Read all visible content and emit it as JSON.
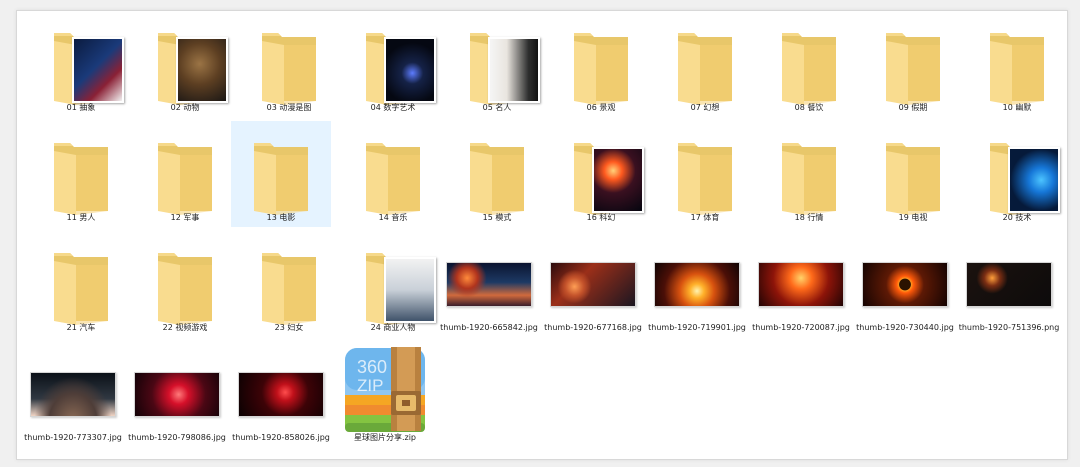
{
  "folders": [
    {
      "name": "01 抽象",
      "thumb": "abstract"
    },
    {
      "name": "02 动物",
      "thumb": "animal"
    },
    {
      "name": "03 动漫是图",
      "thumb": ""
    },
    {
      "name": "04 数字艺术",
      "thumb": "space"
    },
    {
      "name": "05 名人",
      "thumb": "person"
    },
    {
      "name": "06 景观",
      "thumb": ""
    },
    {
      "name": "07 幻想",
      "thumb": ""
    },
    {
      "name": "08 餐饮",
      "thumb": ""
    },
    {
      "name": "09 假期",
      "thumb": ""
    },
    {
      "name": "10 幽默",
      "thumb": ""
    },
    {
      "name": "11 男人",
      "thumb": ""
    },
    {
      "name": "12 军事",
      "thumb": ""
    },
    {
      "name": "13 电影",
      "thumb": "",
      "selected": true
    },
    {
      "name": "14 音乐",
      "thumb": ""
    },
    {
      "name": "15 模式",
      "thumb": ""
    },
    {
      "name": "16 科幻",
      "thumb": "scifi"
    },
    {
      "name": "17 体育",
      "thumb": ""
    },
    {
      "name": "18 行情",
      "thumb": ""
    },
    {
      "name": "19 电视",
      "thumb": ""
    },
    {
      "name": "20 技术",
      "thumb": "windows"
    },
    {
      "name": "21 汽车",
      "thumb": ""
    },
    {
      "name": "22 视频游戏",
      "thumb": ""
    },
    {
      "name": "23 妇女",
      "thumb": ""
    },
    {
      "name": "24 商业人物",
      "thumb": "business"
    }
  ],
  "images": [
    {
      "name": "thumb-1920-665842.jpg",
      "style": "clouds"
    },
    {
      "name": "thumb-1920-677168.jpg",
      "style": "nebula"
    },
    {
      "name": "thumb-1920-719901.jpg",
      "style": "sunrise"
    },
    {
      "name": "thumb-1920-720087.jpg",
      "style": "fire"
    },
    {
      "name": "thumb-1920-730440.jpg",
      "style": "eclipse"
    },
    {
      "name": "thumb-1920-751396.png",
      "style": "dark"
    },
    {
      "name": "thumb-1920-773307.jpg",
      "style": "planet"
    },
    {
      "name": "thumb-1920-798086.jpg",
      "style": "red"
    },
    {
      "name": "thumb-1920-858026.jpg",
      "style": "redspace"
    }
  ],
  "archive": {
    "name": "星球图片分享.zip",
    "brand_top": "360",
    "brand_bottom": "ZIP"
  },
  "colors": {
    "folder_back": "#e8c76a",
    "folder_front": "#f9dc8f",
    "selection": "#e5f3ff"
  }
}
